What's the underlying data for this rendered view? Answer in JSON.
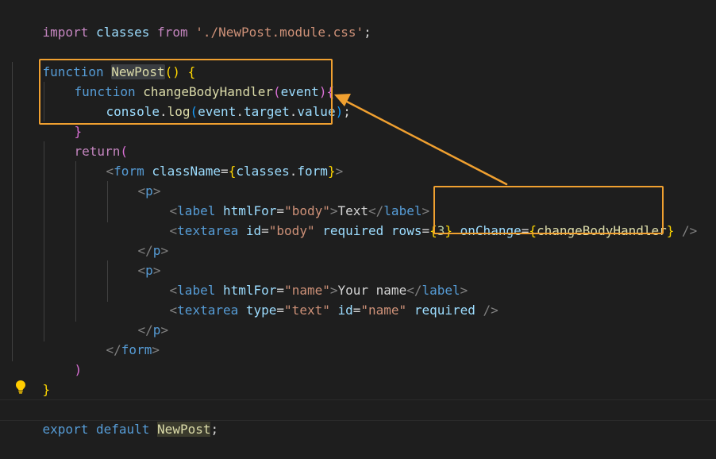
{
  "lines": [
    [
      "import",
      " ",
      "classes",
      " ",
      "from",
      " ",
      "'./NewPost.module.css'",
      ";"
    ],
    [],
    [
      "function",
      " ",
      "NewPost",
      "()",
      " ",
      "{"
    ],
    [
      "function",
      " ",
      "changeBodyHandler",
      "(",
      "event",
      ")",
      "{"
    ],
    [
      "console",
      ".",
      "log",
      "(",
      "event",
      ".",
      "target",
      ".",
      "value",
      ")",
      ";"
    ],
    [
      "}"
    ],
    [
      "return",
      "("
    ],
    [
      "<",
      "form",
      " ",
      "className",
      "=",
      "{",
      "classes",
      ".",
      "form",
      "}",
      ">"
    ],
    [
      "<",
      "p",
      ">"
    ],
    [
      "<",
      "label",
      " ",
      "htmlFor",
      "=",
      "\"body\"",
      ">",
      "Text",
      "</",
      "label",
      ">"
    ],
    [
      "<",
      "textarea",
      " ",
      "id",
      "=",
      "\"body\"",
      " ",
      "required",
      " ",
      "rows",
      "=",
      "{",
      "3",
      "}",
      " ",
      "onChange",
      "=",
      "{",
      "changeBodyHandler",
      "}",
      " ",
      "/>"
    ],
    [
      "</",
      "p",
      ">"
    ],
    [
      "<",
      "p",
      ">"
    ],
    [
      "<",
      "label",
      " ",
      "htmlFor",
      "=",
      "\"name\"",
      ">",
      "Your name",
      "</",
      "label",
      ">"
    ],
    [
      "<",
      "textarea",
      " ",
      "type",
      "=",
      "\"text\"",
      " ",
      "id",
      "=",
      "\"name\"",
      " ",
      "required",
      " ",
      "/>"
    ],
    [
      "</",
      "p",
      ">"
    ],
    [
      "</",
      "form",
      ">"
    ],
    [
      ")"
    ],
    [
      "}"
    ],
    [],
    [
      "export",
      " ",
      "default",
      " ",
      "NewPost",
      ";"
    ]
  ],
  "colors": {
    "background": "#1e1e1e",
    "annotation": "#f0a030"
  },
  "icons": {
    "lightbulb": "lightbulb-icon"
  }
}
